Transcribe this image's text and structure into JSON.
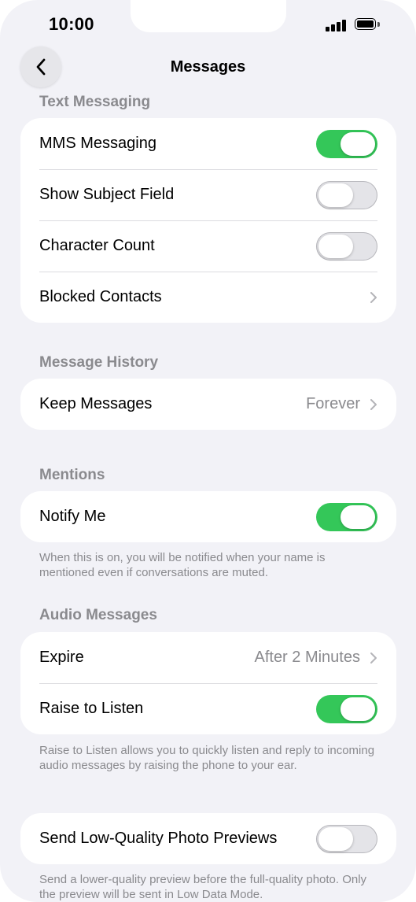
{
  "status_bar": {
    "time": "10:00"
  },
  "nav": {
    "title": "Messages",
    "back_icon": "chevron-left-icon"
  },
  "sections": {
    "text_messaging": {
      "header": "Text Messaging",
      "rows": [
        {
          "label": "MMS Messaging",
          "toggle": true
        },
        {
          "label": "Show Subject Field",
          "toggle": false
        },
        {
          "label": "Character Count",
          "toggle": false
        },
        {
          "label": "Blocked Contacts"
        }
      ]
    },
    "message_history": {
      "header": "Message History",
      "rows": [
        {
          "label": "Keep Messages",
          "value": "Forever"
        }
      ]
    },
    "mentions": {
      "header": "Mentions",
      "rows": [
        {
          "label": "Notify Me",
          "toggle": true
        }
      ],
      "footer": "When this is on, you will be notified when your name is mentioned even if conversations are muted."
    },
    "audio_messages": {
      "header": "Audio Messages",
      "rows": [
        {
          "label": "Expire",
          "value": "After 2 Minutes"
        },
        {
          "label": "Raise to Listen",
          "toggle": true
        }
      ],
      "footer": "Raise to Listen allows you to quickly listen and reply to incoming audio messages by raising the phone to your ear."
    },
    "low_quality": {
      "rows": [
        {
          "label": "Send Low-Quality Photo Previews",
          "toggle": false
        }
      ],
      "footer": "Send a lower-quality preview before the full-quality photo. Only the preview will be sent in Low Data Mode."
    }
  },
  "colors": {
    "toggle_on": "#34c759",
    "background": "#f2f2f7",
    "secondary_text": "#8a8a8e"
  }
}
